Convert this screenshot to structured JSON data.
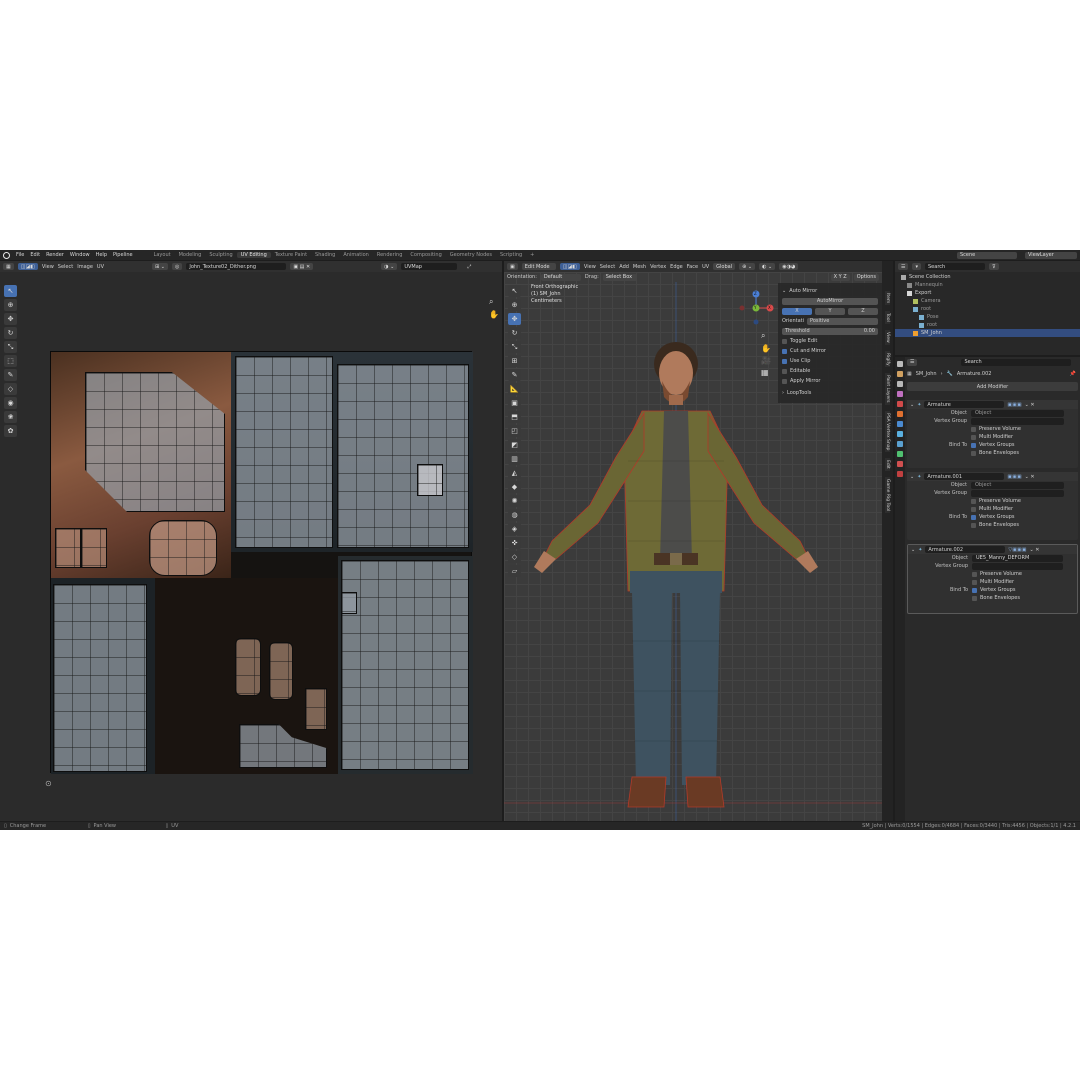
{
  "menubar": {
    "menus": [
      "File",
      "Edit",
      "Render",
      "Window",
      "Help",
      "Pipeline"
    ],
    "workspaces": [
      "Layout",
      "Modeling",
      "Sculpting",
      "UV Editing",
      "Texture Paint",
      "Shading",
      "Animation",
      "Rendering",
      "Compositing",
      "Geometry Nodes",
      "Scripting"
    ],
    "active_workspace": "UV Editing",
    "add_symbol": "+",
    "scene": "Scene",
    "view_layer": "ViewLayer"
  },
  "uv_editor": {
    "menus": [
      "View",
      "Select",
      "Image",
      "UV"
    ],
    "image_name": "John_Texture02_Dither.png",
    "uv_map": "UVMap"
  },
  "viewport": {
    "mode": "Edit Mode",
    "menus": [
      "View",
      "Select",
      "Add",
      "Mesh",
      "Vertex",
      "Edge",
      "Face",
      "UV"
    ],
    "transform_orientation": "Global",
    "orientation_label": "Orientation:",
    "orientation_value": "Default",
    "drag_label": "Drag:",
    "drag_value": "Select Box",
    "options": "Options",
    "view_name": "Front Orthographic",
    "object_line": "(1) SM_John",
    "units": "Centimeters",
    "gizmo": {
      "z": "Z",
      "x": "X",
      "y": "Y"
    },
    "auto_mirror": {
      "panel_title": "Auto Mirror",
      "button": "AutoMirror",
      "axes": [
        "X",
        "Y",
        "Z"
      ],
      "orientation_label": "Orientati...",
      "orientation_value": "Positive",
      "threshold_label": "Threshold",
      "threshold_value": "0.00",
      "toggle_edit": "Toggle Edit",
      "cut_and_mirror": "Cut and Mirror",
      "use_clip": "Use Clip",
      "editable": "Editable",
      "apply_mirror": "Apply Mirror"
    },
    "looptools": "LoopTools",
    "side_tabs": [
      "Item",
      "Tool",
      "View",
      "Rigify",
      "Paint Layers",
      "PSA Vertex Snap",
      "Edit",
      "Game Rig Tool"
    ]
  },
  "outliner": {
    "search_placeholder": "Search",
    "rows": [
      {
        "label": "Scene Collection",
        "indent": 0
      },
      {
        "label": "Mannequin",
        "indent": 1
      },
      {
        "label": "Export",
        "indent": 1
      },
      {
        "label": "Camera",
        "indent": 2
      },
      {
        "label": "root",
        "indent": 2
      },
      {
        "label": "Pose",
        "indent": 3
      },
      {
        "label": "root",
        "indent": 3
      },
      {
        "label": "SM_John",
        "indent": 2
      }
    ]
  },
  "properties": {
    "search_placeholder": "Search",
    "breadcrumb_object": "SM_John",
    "breadcrumb_modifier": "Armature.002",
    "add_modifier": "Add Modifier",
    "modifiers": [
      {
        "name": "Armature",
        "object": "",
        "object_placeholder": "Object",
        "vertex_group": "",
        "preserve_volume": "Preserve Volume",
        "multi_modifier": "Multi Modifier",
        "bind_to": "Bind To",
        "vertex_groups": "Vertex Groups",
        "bone_envelopes": "Bone Envelopes"
      },
      {
        "name": "Armature.001",
        "object": "",
        "object_placeholder": "Object",
        "vertex_group": "",
        "preserve_volume": "Preserve Volume",
        "multi_modifier": "Multi Modifier",
        "bind_to": "Bind To",
        "vertex_groups": "Vertex Groups",
        "bone_envelopes": "Bone Envelopes"
      },
      {
        "name": "Armature.002",
        "object": "UE5_Manny_DEFORM",
        "object_placeholder": "Object",
        "vertex_group": "",
        "preserve_volume": "Preserve Volume",
        "multi_modifier": "Multi Modifier",
        "bind_to": "Bind To",
        "vertex_groups": "Vertex Groups",
        "bone_envelopes": "Bone Envelopes"
      }
    ],
    "labels": {
      "object": "Object",
      "vertex_group": "Vertex Group"
    }
  },
  "statusbar": {
    "left1": "Change Frame",
    "left2": "Pan View",
    "left3": "UV",
    "stats": "SM_John | Verts:0/1554 | Edges:0/4684 | Faces:0/3440 | Tris:4456 | Objects:1/1 | 4.2.1"
  },
  "colors": {
    "accent": "#4772b3",
    "selection": "#334d80",
    "background": "#1d1d1d"
  }
}
